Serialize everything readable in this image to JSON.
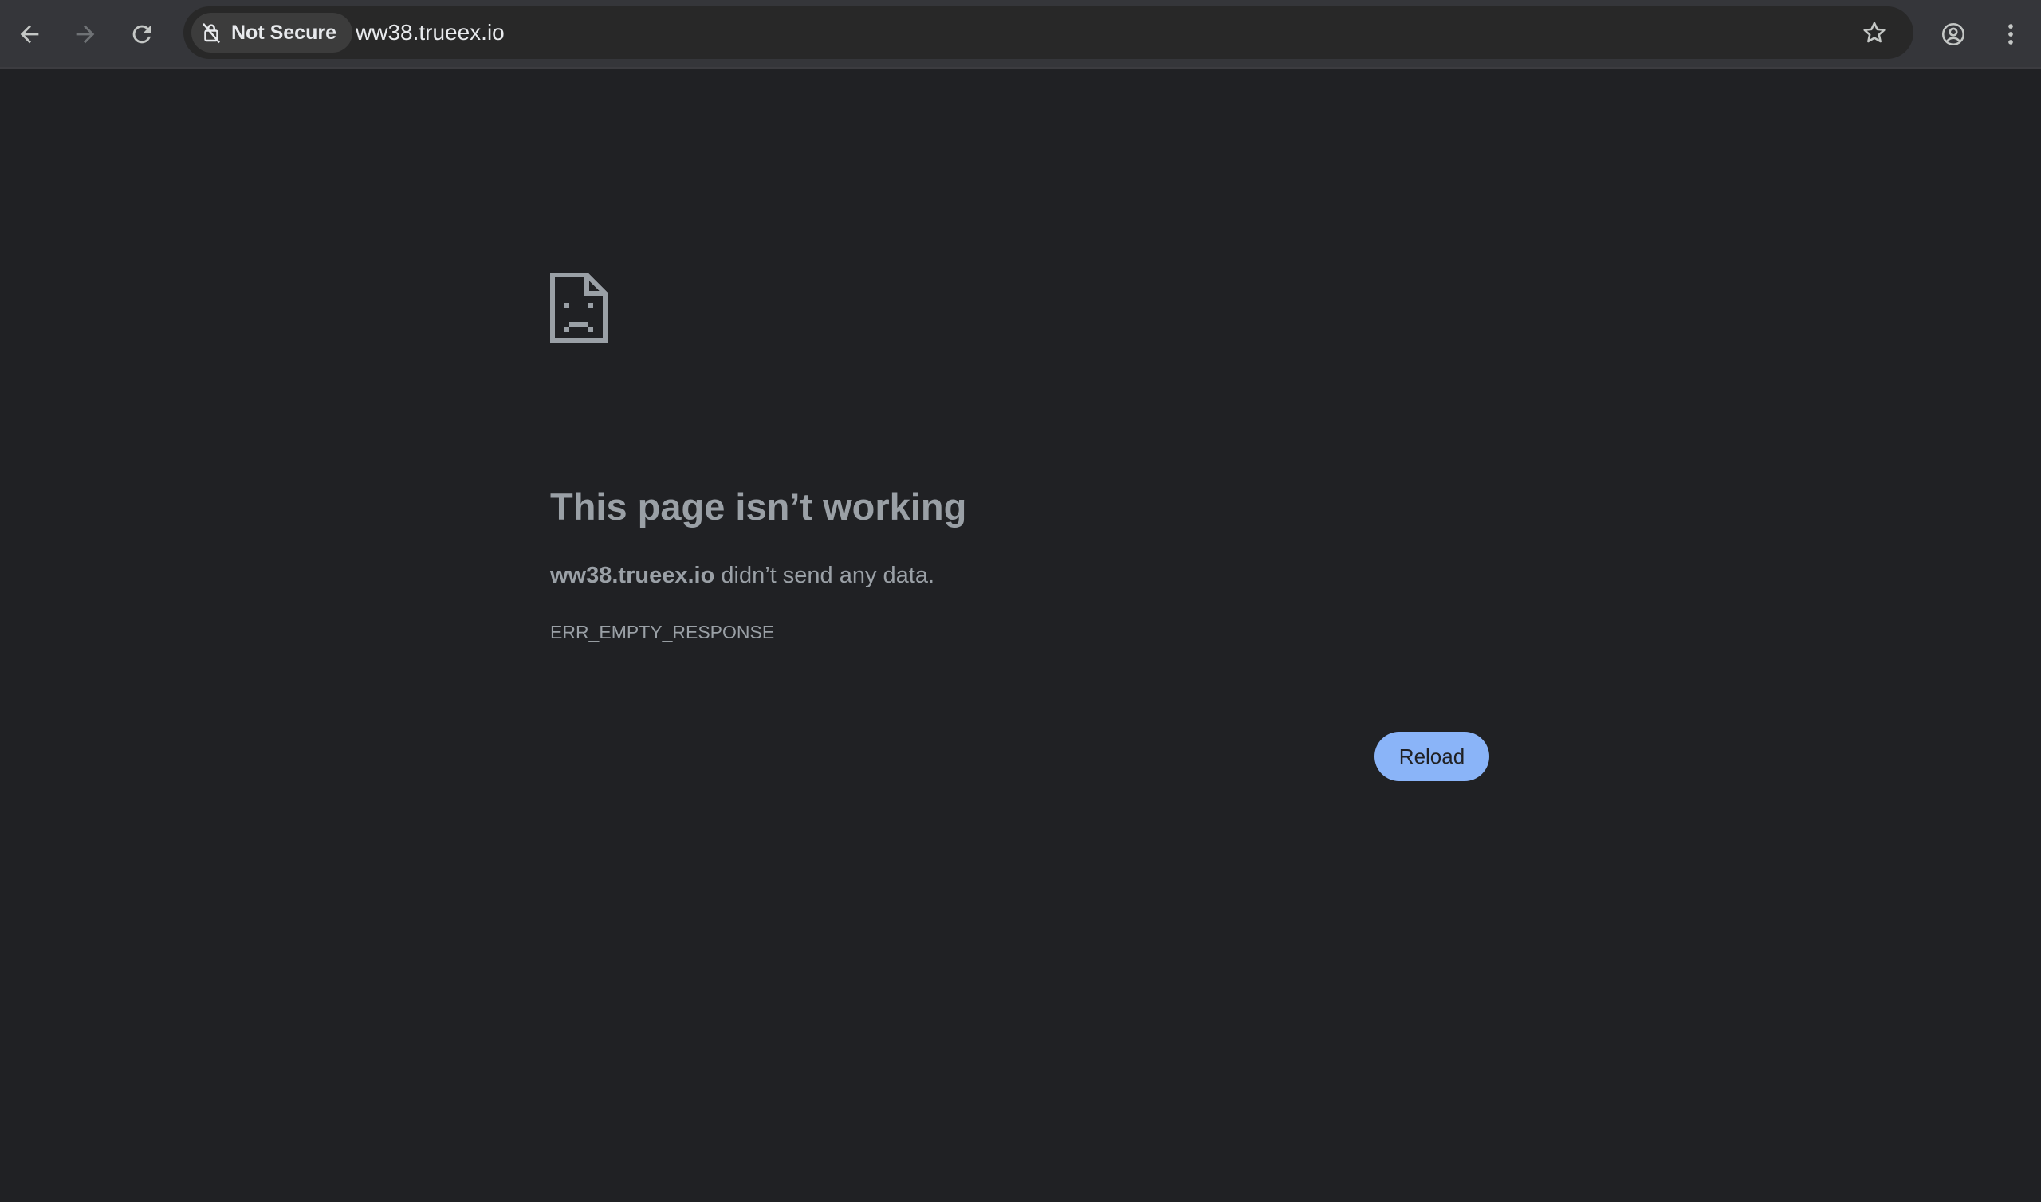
{
  "toolbar": {
    "back_icon": "arrow-left-icon",
    "forward_icon": "arrow-right-icon",
    "reload_icon": "refresh-icon",
    "security_label": "Not Secure",
    "security_icon": "not-secure-lock-icon",
    "url": "ww38.trueex.io",
    "bookmark_icon": "star-icon",
    "profile_icon": "account-circle-icon",
    "menu_icon": "more-vert-icon"
  },
  "error_page": {
    "icon": "sad-page-icon",
    "title": "This page isn’t working",
    "host": "ww38.trueex.io",
    "description_rest": " didn’t send any data.",
    "code": "ERR_EMPTY_RESPONSE",
    "reload_label": "Reload"
  },
  "colors": {
    "background": "#202124",
    "toolbar": "#35363a",
    "text_secondary": "#9aa0a6",
    "accent_button": "#8ab4f8"
  }
}
